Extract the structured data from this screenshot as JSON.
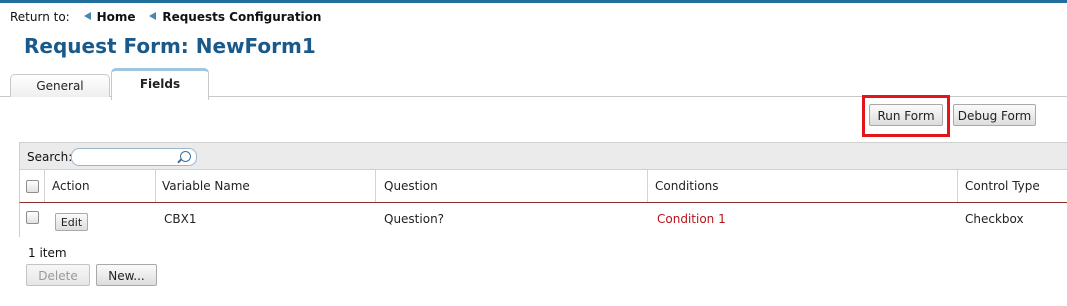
{
  "breadcrumb": {
    "return_label": "Return to:",
    "items": [
      "Home",
      "Requests Configuration"
    ]
  },
  "page": {
    "title": "Request Form: NewForm1"
  },
  "tabs": [
    {
      "label": "General",
      "active": false
    },
    {
      "label": "Fields",
      "active": true
    }
  ],
  "toolbar": {
    "run_form": "Run Form",
    "debug_form": "Debug Form"
  },
  "search": {
    "label": "Search:",
    "value": "",
    "placeholder": ""
  },
  "table": {
    "columns": [
      "Action",
      "Variable Name",
      "Question",
      "Conditions",
      "Control Type"
    ],
    "rows": [
      {
        "action": "Edit",
        "variable_name": "CBX1",
        "question": "Question?",
        "conditions": "Condition 1",
        "control_type": "Checkbox"
      }
    ]
  },
  "footer": {
    "count": "1 item",
    "delete": "Delete",
    "new": "New..."
  },
  "colors": {
    "accent": "#1a5a8a",
    "highlight": "#e3151a",
    "link": "#b3151a"
  }
}
